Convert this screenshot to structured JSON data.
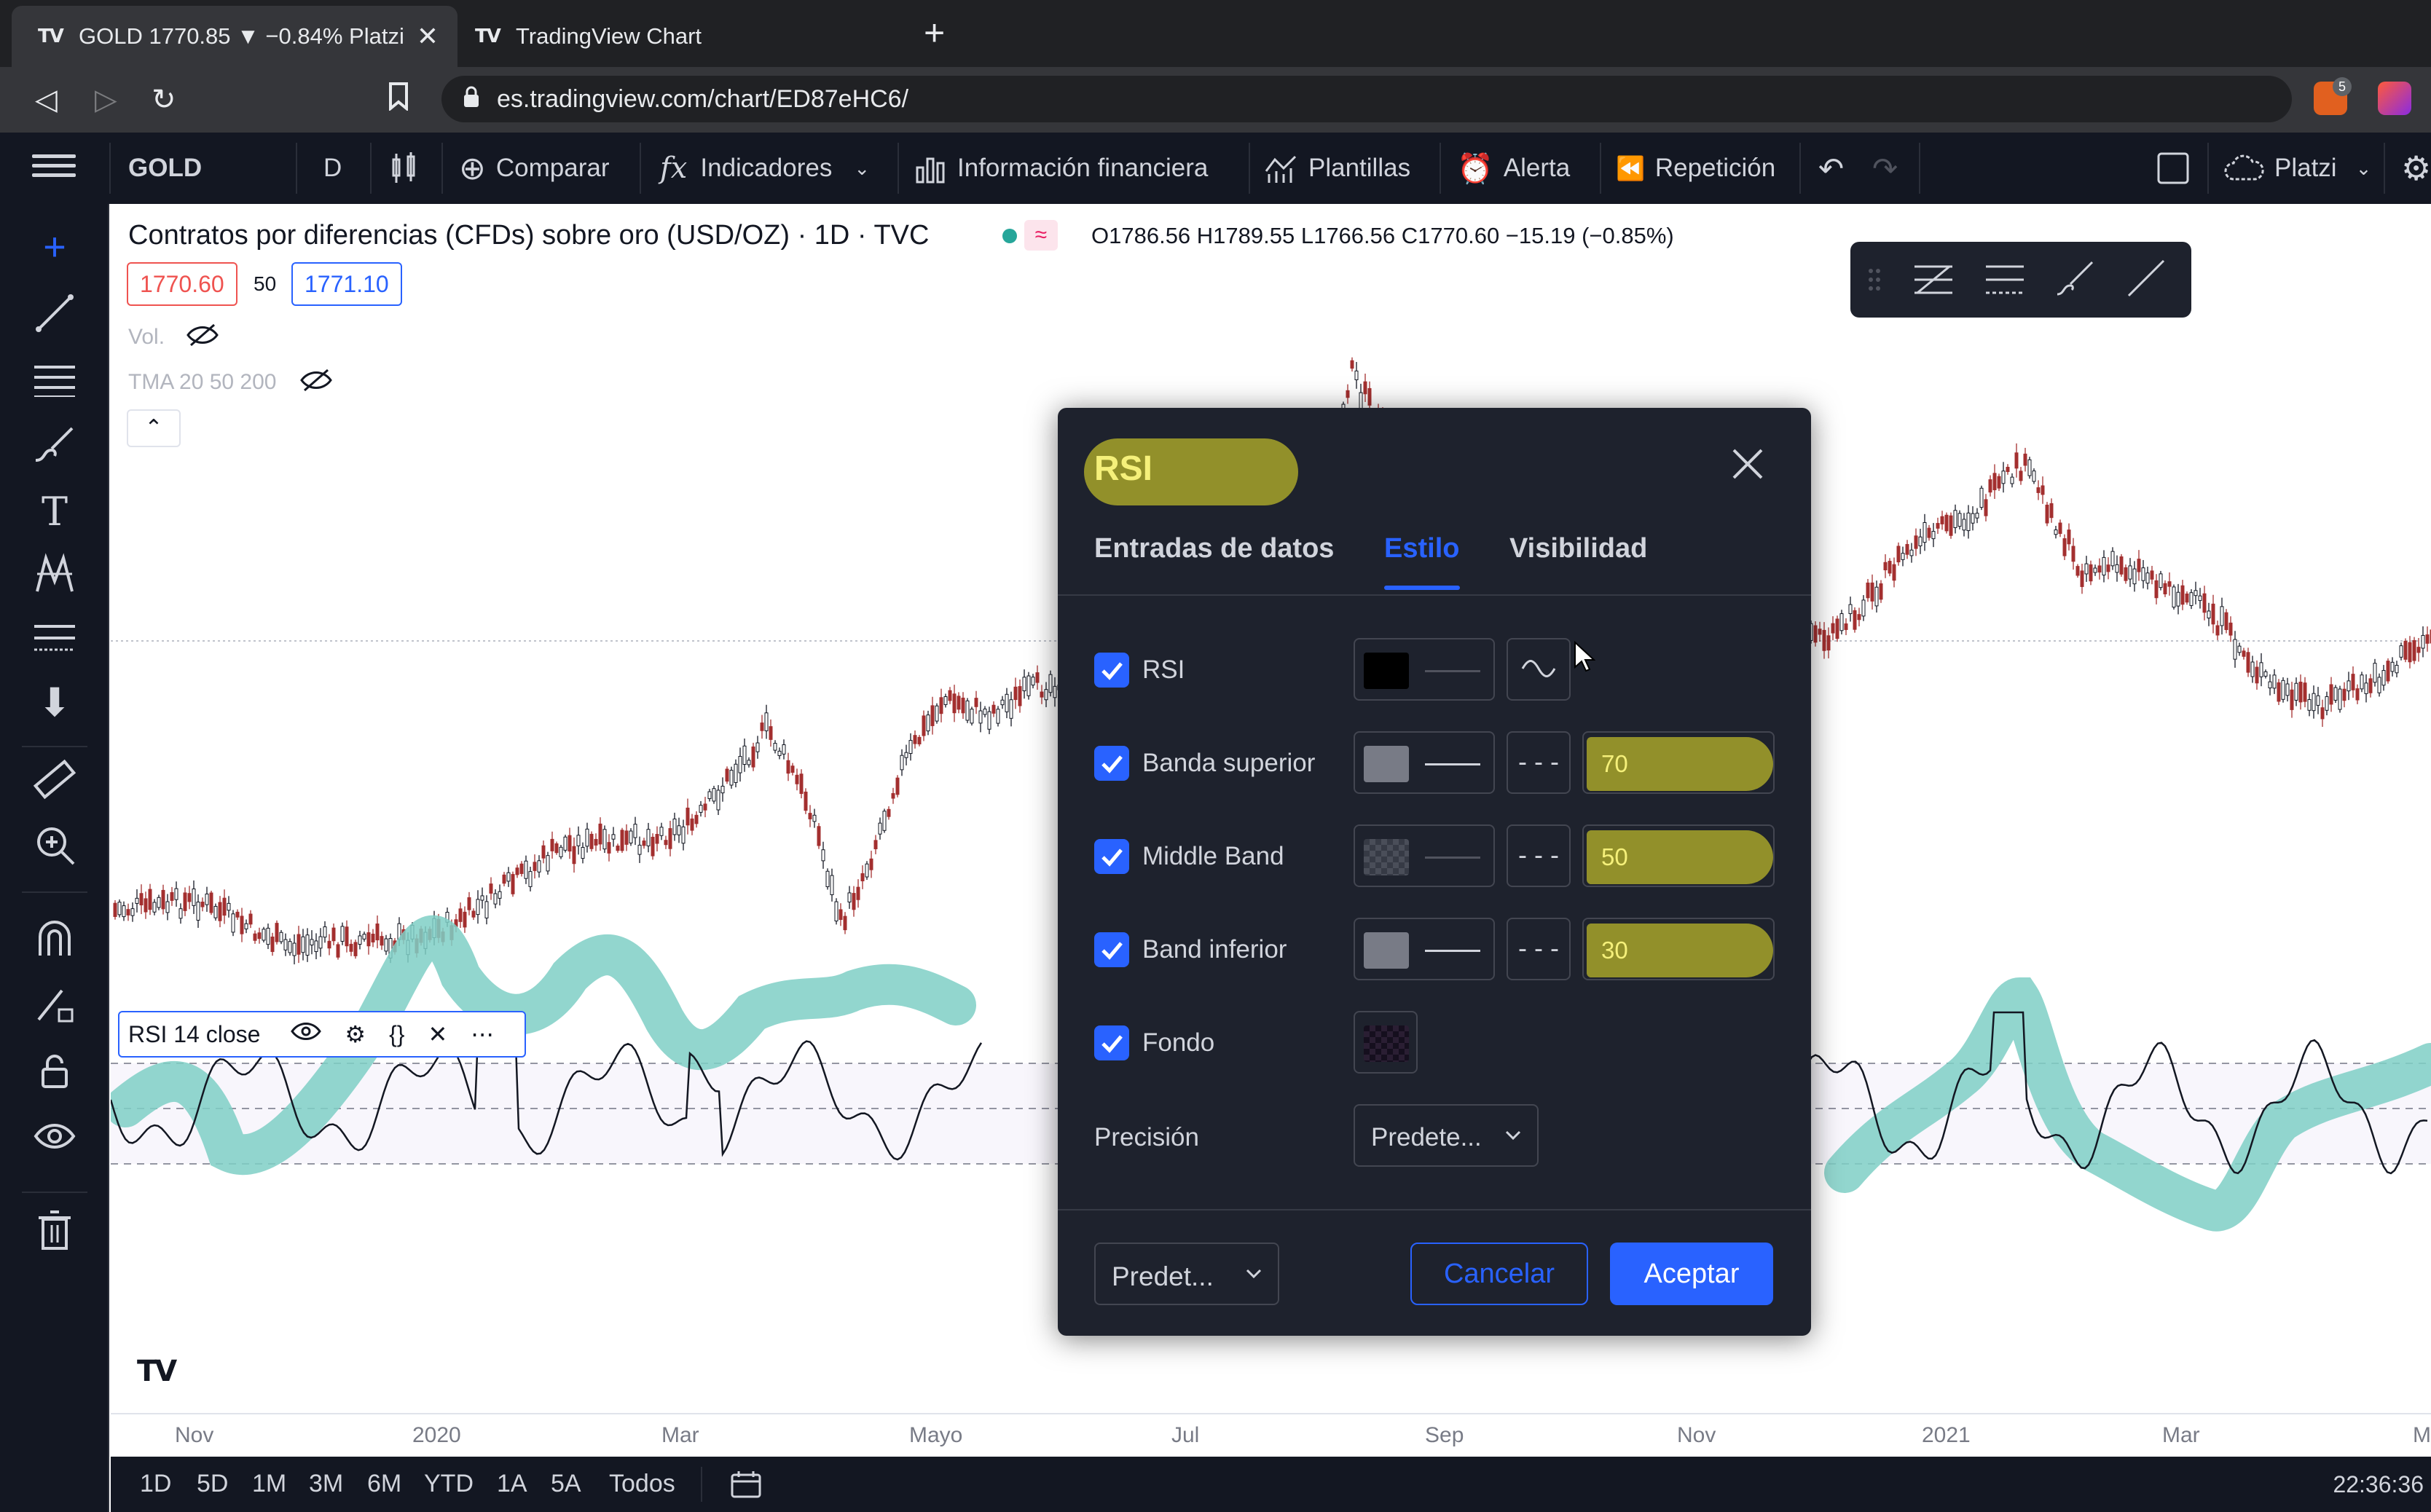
{
  "browser": {
    "tabs": [
      {
        "title": "GOLD 1770.85 ▼ −0.84% Platzi",
        "active": true
      },
      {
        "title": "TradingView Chart",
        "active": false
      }
    ],
    "url": "es.tradingview.com/chart/ED87eHC6/",
    "extension_badges": [
      "5"
    ]
  },
  "toolbar": {
    "symbol": "GOLD",
    "interval": "D",
    "compare": "Comparar",
    "indicators": "Indicadores",
    "financials": "Información financiera",
    "templates": "Plantillas",
    "alert": "Alerta",
    "replay": "Repetición",
    "layout": "Platzi"
  },
  "chart": {
    "title": "Contratos por diferencias (CFDs) sobre oro (USD/OZ) · 1D · TVC",
    "ohlc": "O1786.56  H1789.55  L1766.56  C1770.60  −15.19 (−0.85%)",
    "bid": "1770.60",
    "spread": "50",
    "ask": "1771.10",
    "vol_label": "Vol.",
    "tma_label": "TMA 20 50 200",
    "rsi_legend": "RSI 14 close",
    "time_labels": [
      "Nov",
      "2020",
      "Mar",
      "Mayo",
      "Jul",
      "Sep",
      "Nov",
      "2021",
      "Mar",
      "M"
    ],
    "range_buttons": [
      "1D",
      "5D",
      "1M",
      "3M",
      "6M",
      "YTD",
      "1A",
      "5A",
      "Todos"
    ],
    "clock": "22:36:36",
    "colors": {
      "rsi_highlight": "#7fcfc6",
      "accent": "#2962ff"
    }
  },
  "dialog": {
    "title": "RSI",
    "tabs": [
      "Entradas de datos",
      "Estilo",
      "Visibilidad"
    ],
    "active_tab": "Estilo",
    "rows": [
      {
        "label": "RSI",
        "checked": true,
        "color": "#000000",
        "value": ""
      },
      {
        "label": "Banda superior",
        "checked": true,
        "color": "#787b86",
        "value": "70"
      },
      {
        "label": "Middle Band",
        "checked": true,
        "color": "#4a4e59",
        "value": "50"
      },
      {
        "label": "Band inferior",
        "checked": true,
        "color": "#787b86",
        "value": "30"
      },
      {
        "label": "Fondo",
        "checked": true,
        "color": "#2a1e33",
        "value": ""
      }
    ],
    "precision_label": "Precisión",
    "precision_value": "Predete...",
    "defaults": "Predet...",
    "cancel": "Cancelar",
    "ok": "Aceptar"
  }
}
